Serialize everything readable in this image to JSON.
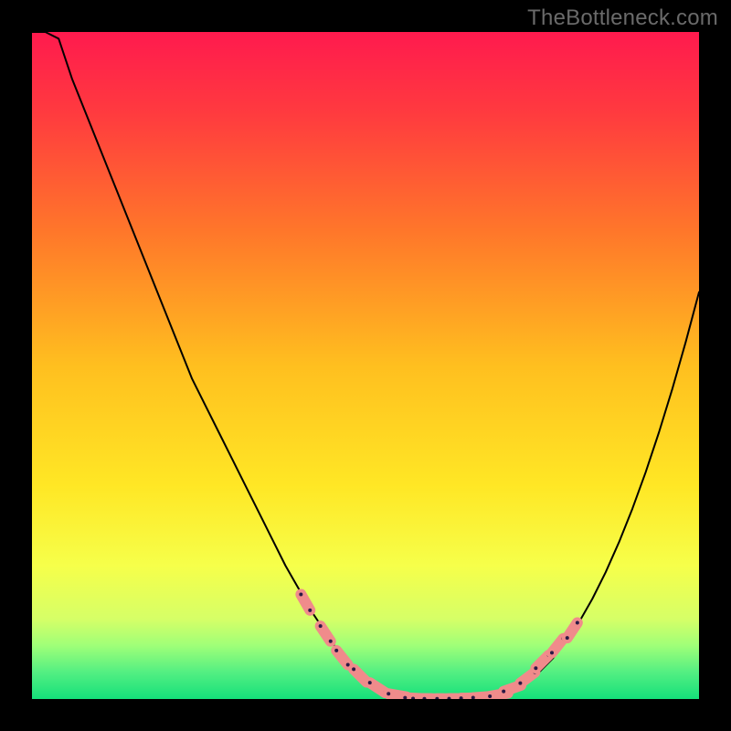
{
  "watermark": "TheBottleneck.com",
  "colors": {
    "gradient_top": "#ff1a4e",
    "gradient_mid": "#ffd21a",
    "gradient_low": "#f3ff60",
    "gradient_bottom": "#15e07a",
    "curve": "#000000",
    "marker_fill": "#f08b8b",
    "marker_stroke": "#2b1a46"
  },
  "chart_data": {
    "type": "line",
    "title": "",
    "xlabel": "",
    "ylabel": "",
    "xlim": [
      0,
      100
    ],
    "ylim": [
      0,
      100
    ],
    "x": [
      0,
      2,
      4,
      6,
      8,
      10,
      12,
      14,
      16,
      18,
      20,
      22,
      24,
      26,
      28,
      30,
      32,
      34,
      36,
      38,
      40,
      42,
      44,
      46,
      48,
      50,
      52,
      54,
      56,
      58,
      60,
      62,
      64,
      66,
      68,
      70,
      72,
      74,
      76,
      78,
      80,
      82,
      84,
      86,
      88,
      90,
      92,
      94,
      96,
      98,
      100
    ],
    "values": [
      112,
      105,
      99,
      93,
      88,
      83,
      78,
      73,
      68,
      63,
      58,
      53,
      48,
      44,
      40,
      36,
      32,
      28,
      24,
      20,
      16.5,
      13,
      10,
      7,
      4.5,
      2.5,
      1.2,
      0.5,
      0.15,
      0.05,
      0.04,
      0.04,
      0.05,
      0.1,
      0.25,
      0.6,
      1.3,
      2.5,
      4,
      6,
      8.5,
      11.5,
      15,
      19,
      23.5,
      28.5,
      34,
      40,
      46.5,
      53.5,
      61
    ],
    "markers": [
      {
        "x": 41,
        "y": 14.5
      },
      {
        "x": 44,
        "y": 9.8
      },
      {
        "x": 46.5,
        "y": 6.2
      },
      {
        "x": 49.2,
        "y": 3.5
      },
      {
        "x": 51.8,
        "y": 1.7
      },
      {
        "x": 54.8,
        "y": 0.55
      },
      {
        "x": 57.3,
        "y": 0.12
      },
      {
        "x": 58.5,
        "y": 0.06
      },
      {
        "x": 60.2,
        "y": 0.04
      },
      {
        "x": 62.1,
        "y": 0.045
      },
      {
        "x": 63.9,
        "y": 0.06
      },
      {
        "x": 65.7,
        "y": 0.15
      },
      {
        "x": 67.5,
        "y": 0.3
      },
      {
        "x": 70.0,
        "y": 0.65
      },
      {
        "x": 72.0,
        "y": 1.6
      },
      {
        "x": 74.3,
        "y": 3.2
      },
      {
        "x": 76.5,
        "y": 5.6
      },
      {
        "x": 78.8,
        "y": 8.0
      },
      {
        "x": 81.0,
        "y": 10.3
      }
    ],
    "gradient_stops": [
      {
        "offset": 0.0,
        "color": "#ff1a4e"
      },
      {
        "offset": 0.12,
        "color": "#ff3a3f"
      },
      {
        "offset": 0.3,
        "color": "#ff772a"
      },
      {
        "offset": 0.5,
        "color": "#ffbf1f"
      },
      {
        "offset": 0.68,
        "color": "#ffe725"
      },
      {
        "offset": 0.8,
        "color": "#f6ff4a"
      },
      {
        "offset": 0.88,
        "color": "#d6ff67"
      },
      {
        "offset": 0.92,
        "color": "#9fff78"
      },
      {
        "offset": 0.96,
        "color": "#53ef82"
      },
      {
        "offset": 1.0,
        "color": "#15e07a"
      }
    ]
  }
}
